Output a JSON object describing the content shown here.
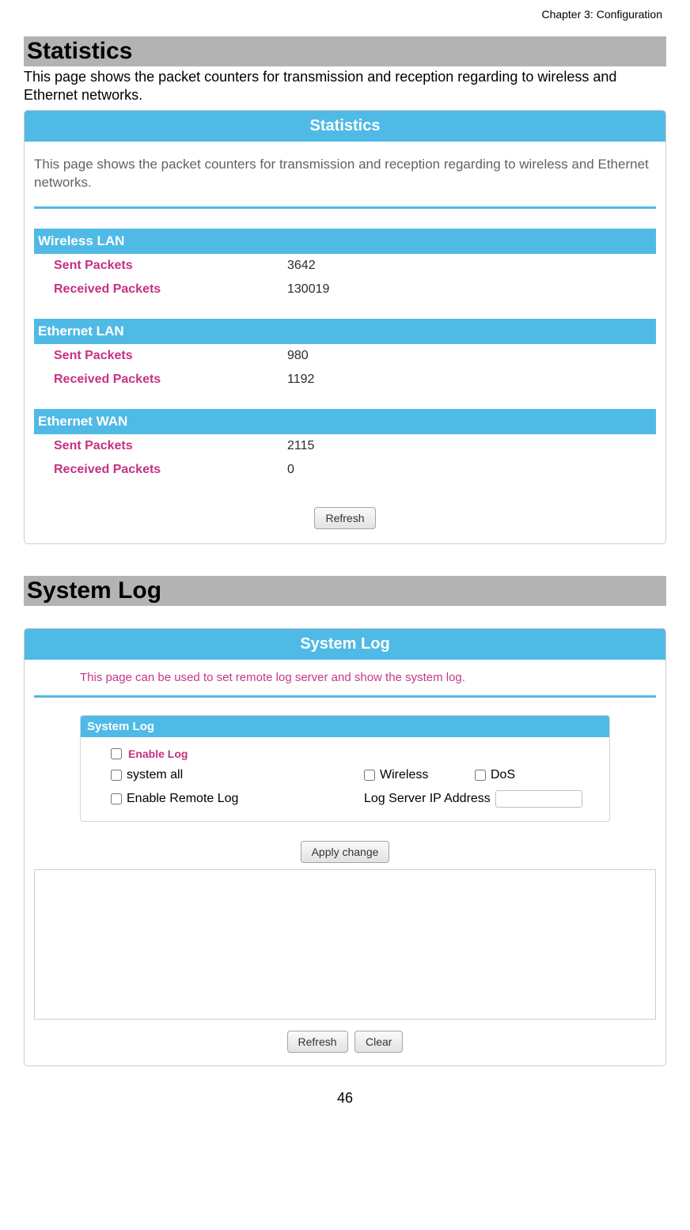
{
  "chapter": "Chapter 3: Configuration",
  "statistics": {
    "title": "Statistics",
    "desc": "This page shows the packet counters for transmission and reception regarding to wireless and Ethernet networks.",
    "panel_title": "Statistics",
    "panel_intro": "This page shows the packet counters for transmission and reception regarding to wireless and Ethernet networks.",
    "groups": [
      {
        "header": "Wireless  LAN",
        "rows": [
          {
            "label": "Sent Packets",
            "value": "3642"
          },
          {
            "label": "Received Packets",
            "value": "130019"
          }
        ]
      },
      {
        "header": "Ethernet LAN",
        "rows": [
          {
            "label": "Sent Packets",
            "value": "980"
          },
          {
            "label": "Received Packets",
            "value": "1192"
          }
        ]
      },
      {
        "header": "Ethernet WAN",
        "rows": [
          {
            "label": "Sent Packets",
            "value": "2115"
          },
          {
            "label": "Received Packets",
            "value": "0"
          }
        ]
      }
    ],
    "refresh_label": "Refresh"
  },
  "systemlog": {
    "title": "System Log",
    "panel_title": "System Log",
    "panel_intro": "This page can be used to set remote log server and show the system log.",
    "box_header": "System Log",
    "enable_log": "Enable Log",
    "system_all": "system all",
    "wireless": "Wireless",
    "dos": "DoS",
    "enable_remote": "Enable Remote Log",
    "log_server_ip": "Log Server IP Address",
    "apply_label": "Apply change",
    "refresh_label": "Refresh",
    "clear_label": "Clear"
  },
  "page_number": "46"
}
